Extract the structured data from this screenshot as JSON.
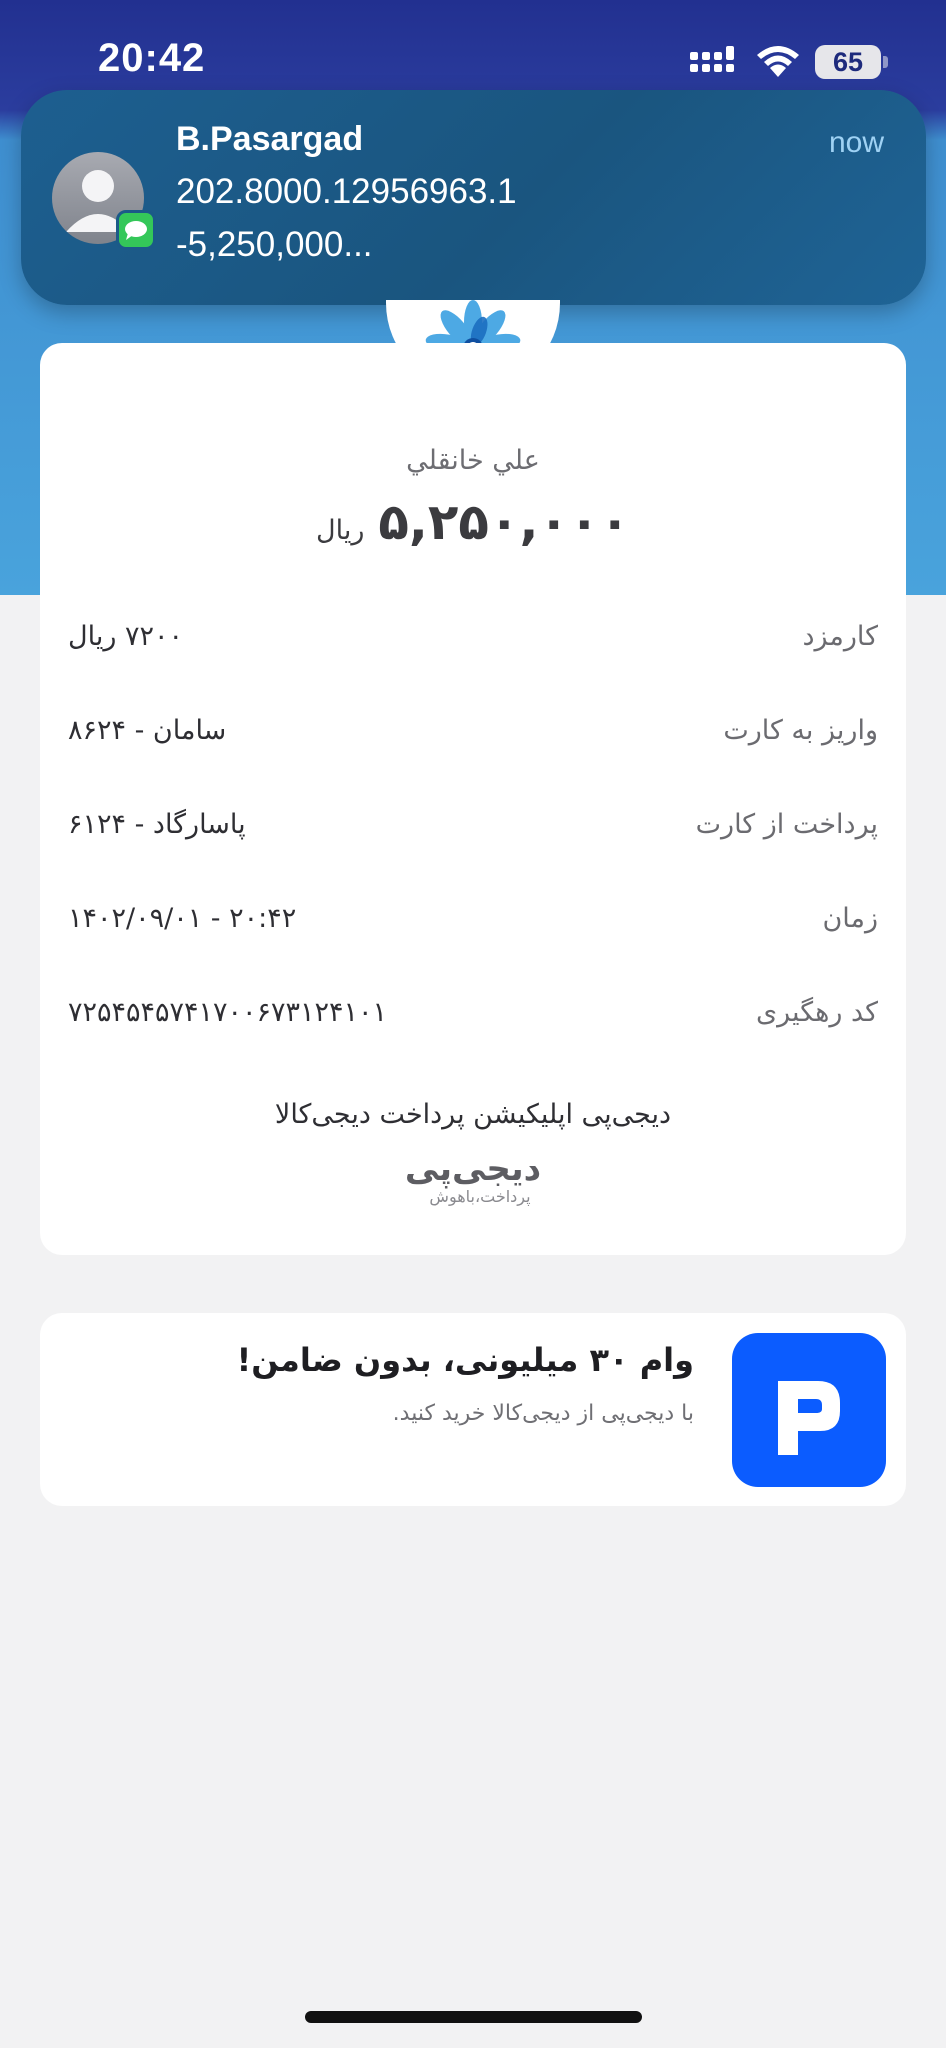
{
  "status_bar": {
    "time": "20:42",
    "battery": "65",
    "icons": [
      "cellular-signal-icon",
      "wifi-icon",
      "battery-icon"
    ]
  },
  "notification": {
    "sender": "B.Pasargad",
    "line1": "202.8000.12956963.1",
    "line2": "-5,250,000...",
    "time": "now",
    "icons": [
      "contact-avatar-icon",
      "messages-app-icon"
    ]
  },
  "receipt": {
    "logo_icon": "bank-flower-logo-icon",
    "payee": "علي خانقلي",
    "amount": "۵,۲۵۰,۰۰۰",
    "amount_unit": "ریال",
    "details": [
      {
        "label": "کارمزد",
        "value": "۷۲۰۰ ریال"
      },
      {
        "label": "واریز به کارت",
        "value": "سامان - ۸۶۲۴"
      },
      {
        "label": "پرداخت از کارت",
        "value": "پاسارگاد - ۶۱۲۴"
      },
      {
        "label": "زمان",
        "value": "۱۴۰۲/۰۹/۰۱ - ۲۰:۴۲"
      },
      {
        "label": "کد رهگیری",
        "value": "۷۲۵۴۵۴۵۷۴۱۷۰۰۶۷۳۱۲۴۱۰۱"
      }
    ],
    "app_promo_text": "دیجی‌پی اپلیکیشن پرداخت دیجی‌کالا",
    "brand_logo": "دیجی‌پی",
    "brand_tagline": "پرداخت،باهوش"
  },
  "promo": {
    "title": "وام ۳۰ میلیونی، بدون ضامن!",
    "subtitle": "با دیجی‌پی از دیجی‌کالا خرید کنید.",
    "icon": "digipay-app-icon"
  },
  "colors": {
    "header_blue": "#2b3d9e",
    "sky_blue": "#49a3dc",
    "notification_bg": "#1a557f",
    "digipay_blue": "#0b5cff",
    "message_green": "#34c759"
  }
}
